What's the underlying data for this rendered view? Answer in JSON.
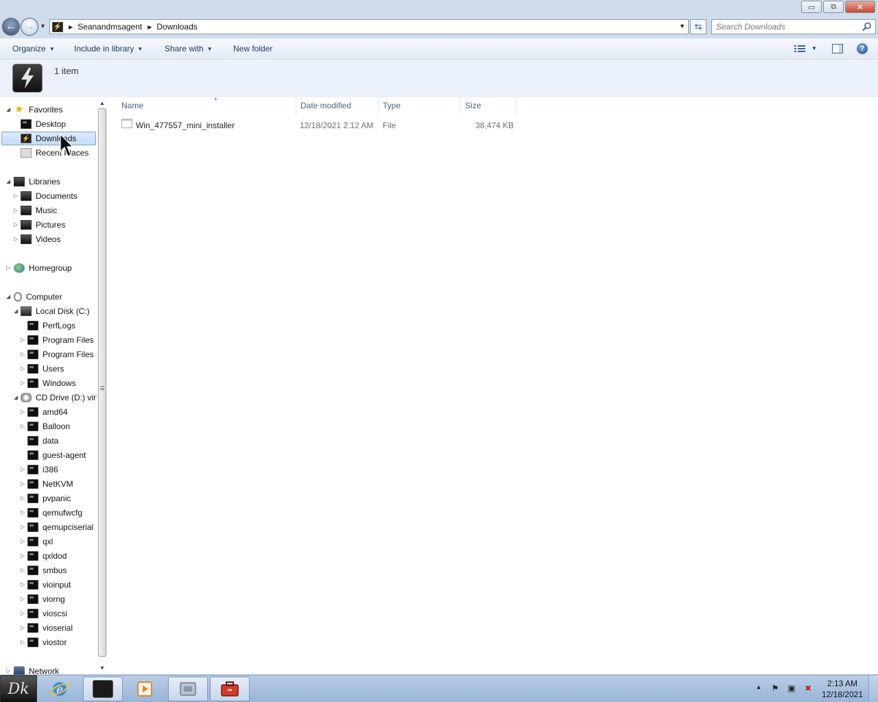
{
  "window": {
    "controls": {
      "minimize": "▭",
      "maximize": "⧉",
      "close": "✕"
    }
  },
  "address": {
    "crumbs": [
      "Seanandmsagent",
      "Downloads"
    ]
  },
  "search": {
    "placeholder": "Search Downloads"
  },
  "toolbar": {
    "organize": "Organize",
    "include_in_library": "Include in library",
    "share_with": "Share with",
    "new_folder": "New folder"
  },
  "details": {
    "count": "1 item"
  },
  "nav": {
    "favorites": "Favorites",
    "desktop": "Desktop",
    "downloads": "Downloads",
    "recent_places": "Recent Places",
    "libraries": "Libraries",
    "documents": "Documents",
    "music": "Music",
    "pictures": "Pictures",
    "videos": "Videos",
    "homegroup": "Homegroup",
    "computer": "Computer",
    "local_disk": "Local Disk (C:)",
    "c_children": [
      "PerfLogs",
      "Program Files",
      "Program Files (",
      "Users",
      "Windows"
    ],
    "cd_drive": "CD Drive (D:) virt",
    "d_children": [
      "amd64",
      "Balloon",
      "data",
      "guest-agent",
      "i386",
      "NetKVM",
      "pvpanic",
      "qemufwcfg",
      "qemupciserial",
      "qxl",
      "qxldod",
      "smbus",
      "vioinput",
      "viorng",
      "vioscsi",
      "vioserial",
      "viostor"
    ],
    "network": "Network"
  },
  "columns": {
    "name": "Name",
    "date": "Date modified",
    "type": "Type",
    "size": "Size"
  },
  "files": [
    {
      "name": "Win_477557_mini_installer",
      "date": "12/18/2021 2:12 AM",
      "type": "File",
      "size": "38,474 KB"
    }
  ],
  "taskbar": {
    "start_label": "Dk",
    "time": "2:13 AM",
    "date": "12/18/2021"
  },
  "colors": {
    "accent": "#1e395b",
    "selection": "#c2dcf8",
    "taskbar": "#98b5d8"
  }
}
